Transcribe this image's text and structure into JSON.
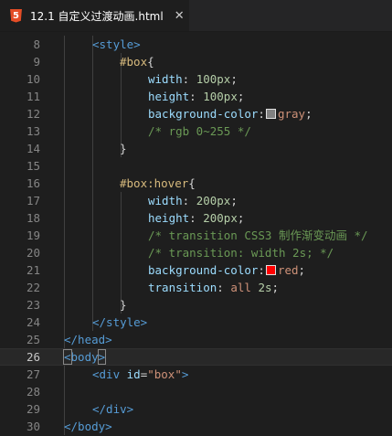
{
  "tab": {
    "title": "12.1 自定义过渡动画.html",
    "icon": "html5-icon",
    "close": "✕"
  },
  "colors": {
    "gray_swatch": "#808080",
    "red_swatch": "#ff0000"
  },
  "lines": [
    {
      "n": "8",
      "t": [
        [
          "tag",
          "<style>"
        ]
      ]
    },
    {
      "n": "9",
      "t": [
        [
          "sel",
          "#box"
        ],
        [
          "punc",
          "{"
        ]
      ]
    },
    {
      "n": "10",
      "t": [
        [
          "prop",
          "width"
        ],
        [
          "punc",
          ": "
        ],
        [
          "num",
          "100px"
        ],
        [
          "punc",
          ";"
        ]
      ]
    },
    {
      "n": "11",
      "t": [
        [
          "prop",
          "height"
        ],
        [
          "punc",
          ": "
        ],
        [
          "num",
          "100px"
        ],
        [
          "punc",
          ";"
        ]
      ]
    },
    {
      "n": "12",
      "t": [
        [
          "prop",
          "background-color"
        ],
        [
          "punc",
          ":"
        ],
        [
          "swatch",
          "gray_swatch"
        ],
        [
          "val",
          "gray"
        ],
        [
          "punc",
          ";"
        ]
      ]
    },
    {
      "n": "13",
      "t": [
        [
          "cmt",
          "/* rgb 0~255 */"
        ]
      ]
    },
    {
      "n": "14",
      "t": [
        [
          "punc",
          "}"
        ]
      ]
    },
    {
      "n": "15",
      "t": []
    },
    {
      "n": "16",
      "t": [
        [
          "sel",
          "#box:hover"
        ],
        [
          "punc",
          "{"
        ]
      ]
    },
    {
      "n": "17",
      "t": [
        [
          "prop",
          "width"
        ],
        [
          "punc",
          ": "
        ],
        [
          "num",
          "200px"
        ],
        [
          "punc",
          ";"
        ]
      ]
    },
    {
      "n": "18",
      "t": [
        [
          "prop",
          "height"
        ],
        [
          "punc",
          ": "
        ],
        [
          "num",
          "200px"
        ],
        [
          "punc",
          ";"
        ]
      ]
    },
    {
      "n": "19",
      "t": [
        [
          "cmt",
          "/* transition CSS3 制作渐变动画 */"
        ]
      ]
    },
    {
      "n": "20",
      "t": [
        [
          "cmt",
          "/* transition: width 2s; */"
        ]
      ]
    },
    {
      "n": "21",
      "t": [
        [
          "prop",
          "background-color"
        ],
        [
          "punc",
          ":"
        ],
        [
          "swatch",
          "red_swatch"
        ],
        [
          "val",
          "red"
        ],
        [
          "punc",
          ";"
        ]
      ]
    },
    {
      "n": "22",
      "t": [
        [
          "prop",
          "transition"
        ],
        [
          "punc",
          ": "
        ],
        [
          "val",
          "all"
        ],
        [
          "punc",
          " "
        ],
        [
          "num",
          "2s"
        ],
        [
          "punc",
          ";"
        ]
      ]
    },
    {
      "n": "23",
      "t": [
        [
          "punc",
          "}"
        ]
      ]
    },
    {
      "n": "24",
      "t": [
        [
          "tag",
          "</style>"
        ]
      ]
    },
    {
      "n": "25",
      "t": [
        [
          "tag",
          "</head>"
        ]
      ]
    },
    {
      "n": "26",
      "t": [
        [
          "tag",
          "<"
        ],
        [
          "tag",
          "body"
        ],
        [
          "tag",
          ">"
        ]
      ]
    },
    {
      "n": "27",
      "t": [
        [
          "tag",
          "<div "
        ],
        [
          "attr",
          "id"
        ],
        [
          "punc",
          "="
        ],
        [
          "str",
          "\"box\""
        ],
        [
          "tag",
          ">"
        ]
      ]
    },
    {
      "n": "28",
      "t": []
    },
    {
      "n": "29",
      "t": [
        [
          "tag",
          "</div>"
        ]
      ]
    },
    {
      "n": "30",
      "t": [
        [
          "tag",
          "</body>"
        ]
      ]
    }
  ],
  "active_line": "26"
}
